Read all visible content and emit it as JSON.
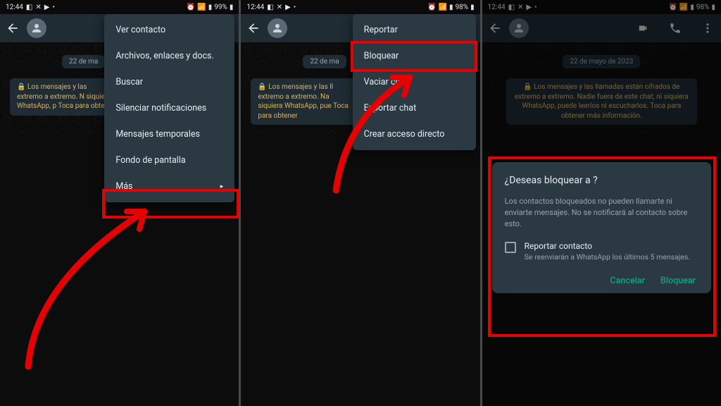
{
  "status": {
    "time": "12:44",
    "battery1": "99%",
    "battery2": "98%",
    "battery3": "98%"
  },
  "date_chip": "22 de mayo de 2023",
  "date_chip_short": "22 de ma",
  "encryption": {
    "full": "🔒 Los mensajes y las llamadas están cifrados de extremo a extremo. Nadie fuera de este chat, ni siquiera WhatsApp, puede leerlos ni escucharlos. Toca para obtener más información.",
    "truncated1": "🔒 Los mensajes y las extremo a extremo. N siquiera WhatsApp, p Toca para obtene",
    "truncated2": "🔒 Los mensajes y las ll extremo a extremo. Na siquiera WhatsApp, pue Toca para obtener"
  },
  "menu1": {
    "items": [
      "Ver contacto",
      "Archivos, enlaces y docs.",
      "Buscar",
      "Silenciar notificaciones",
      "Mensajes temporales",
      "Fondo de pantalla",
      "Más"
    ]
  },
  "menu2": {
    "items": [
      "Reportar",
      "Bloquear",
      "Vaciar chat",
      "Exportar chat",
      "Crear acceso directo"
    ]
  },
  "dialog": {
    "title": "¿Deseas bloquear a              ?",
    "body": "Los contactos bloqueados no pueden llamarte ni enviarte mensajes. No se notificará al contacto sobre esto.",
    "check_label": "Reportar contacto",
    "check_sub": "Se reenviarán a WhatsApp los últimos 5 mensajes.",
    "cancel": "Cancelar",
    "confirm": "Bloquear"
  }
}
